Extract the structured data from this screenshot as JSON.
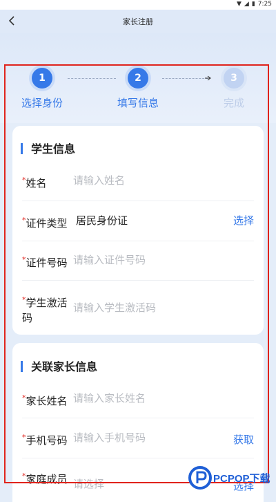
{
  "status_bar": {
    "time": "7:25"
  },
  "header": {
    "title": "家长注册"
  },
  "steps": [
    {
      "num": "1",
      "label": "选择身份"
    },
    {
      "num": "2",
      "label": "填写信息"
    },
    {
      "num": "3",
      "label": "完成"
    }
  ],
  "student": {
    "title": "学生信息",
    "name_label": "姓名",
    "name_placeholder": "请输入姓名",
    "idtype_label": "证件类型",
    "idtype_value": "居民身份证",
    "idtype_action": "选择",
    "idnum_label": "证件号码",
    "idnum_placeholder": "请输入证件号码",
    "code_label_1": "学生激活",
    "code_label_2": "码",
    "code_placeholder": "请输入学生激活码"
  },
  "parent": {
    "title": "关联家长信息",
    "name_label": "家长姓名",
    "name_placeholder": "请输入家长姓名",
    "phone_label": "手机号码",
    "phone_placeholder": "请输入手机号码",
    "phone_action": "获取",
    "member_label": "家庭成员",
    "member_placeholder": "请选择",
    "member_action": "选择"
  },
  "watermark": {
    "text": "PCPOP下载"
  }
}
